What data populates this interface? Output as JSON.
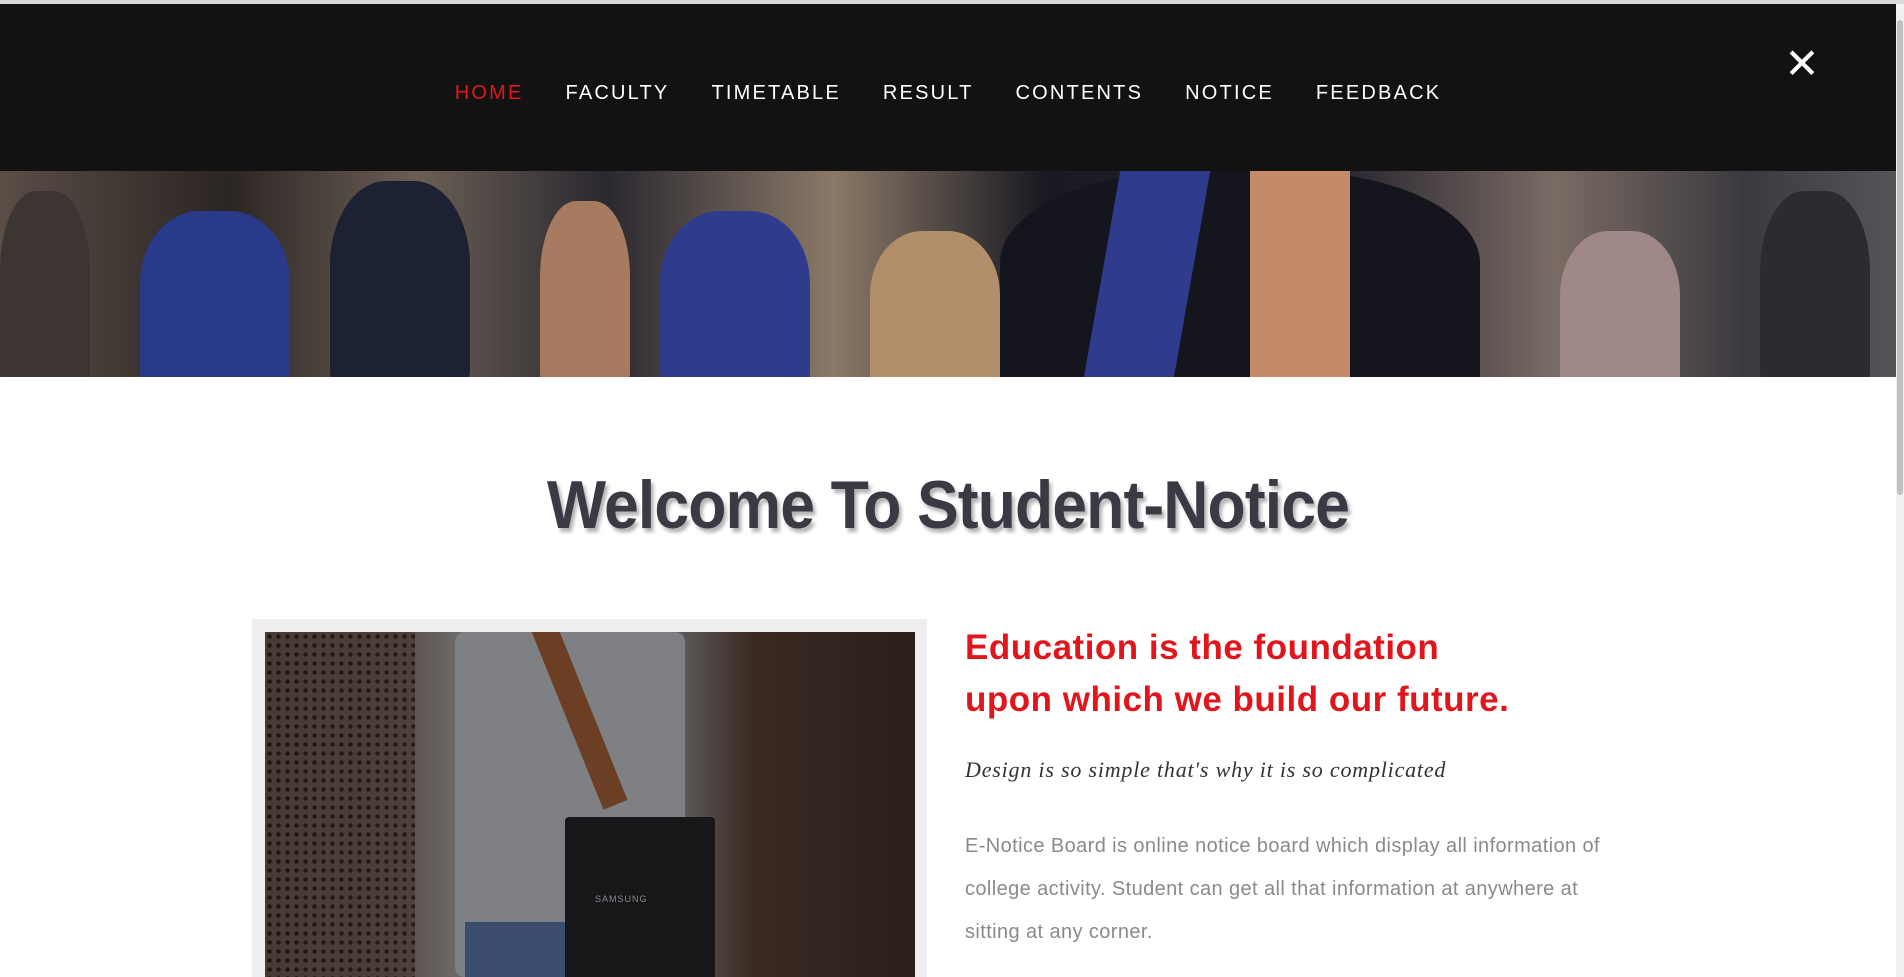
{
  "nav": {
    "items": [
      {
        "label": "HOME",
        "active": true
      },
      {
        "label": "FACULTY",
        "active": false
      },
      {
        "label": "TIMETABLE",
        "active": false
      },
      {
        "label": "RESULT",
        "active": false
      },
      {
        "label": "CONTENTS",
        "active": false
      },
      {
        "label": "NOTICE",
        "active": false
      },
      {
        "label": "FEEDBACK",
        "active": false
      }
    ],
    "close_symbol": "✕",
    "close_icon": "close-icon"
  },
  "main": {
    "heading": "Welcome To Student-Notice",
    "quote": "Education is the foundation upon which we build our future.",
    "subtitle": "Design is so simple that's why it is so complicated",
    "description": "E-Notice Board is online notice board which display all information of college activity. Student can get all that information at anywhere at sitting at any corner.",
    "photo_brand": "SAMSUNG"
  },
  "colors": {
    "accent": "#e0161d",
    "navbar": "#121212",
    "heading": "#3a3a44"
  }
}
